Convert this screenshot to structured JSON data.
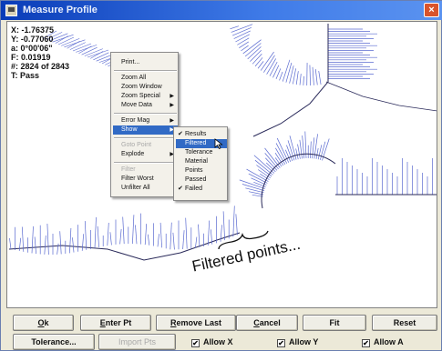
{
  "window": {
    "title": "Measure Profile",
    "close_glyph": "×"
  },
  "readout": [
    "X: -1.76375",
    "Y: -0.77060",
    "a: 0°00'06\"",
    "F: 0.01919",
    "#: 2824 of 2843",
    "T: Pass"
  ],
  "annotation": "Filtered points...",
  "context_menu": {
    "items": [
      {
        "label": "Print...",
        "disabled": false,
        "submenu": false
      },
      {
        "label": "Zoom All",
        "disabled": false,
        "submenu": false
      },
      {
        "label": "Zoom Window",
        "disabled": false,
        "submenu": false
      },
      {
        "label": "Zoom Special",
        "disabled": false,
        "submenu": true
      },
      {
        "label": "Move Data",
        "disabled": false,
        "submenu": true
      },
      {
        "label": "Error Mag",
        "disabled": false,
        "submenu": true
      },
      {
        "label": "Show",
        "disabled": false,
        "submenu": true,
        "highlighted": true
      },
      {
        "label": "Goto Point",
        "disabled": true,
        "submenu": false
      },
      {
        "label": "Explode",
        "disabled": false,
        "submenu": true
      },
      {
        "label": "Filter",
        "disabled": true,
        "submenu": false
      },
      {
        "label": "Filter Worst",
        "disabled": false,
        "submenu": false
      },
      {
        "label": "Unfilter All",
        "disabled": false,
        "submenu": false
      }
    ]
  },
  "show_submenu": {
    "items": [
      {
        "label": "Results",
        "checked": true
      },
      {
        "label": "Filtered",
        "checked": false,
        "highlighted": true
      },
      {
        "label": "Tolerance",
        "checked": false
      },
      {
        "label": "Material",
        "checked": false
      },
      {
        "label": "Points",
        "checked": false
      },
      {
        "label": "Passed",
        "checked": false
      },
      {
        "label": "Failed",
        "checked": true
      }
    ],
    "check_glyph": "✔"
  },
  "buttons": {
    "ok": {
      "hotkey": "O",
      "rest": "k"
    },
    "enter_pt": {
      "hotkey": "E",
      "rest": "nter Pt"
    },
    "remove_last": {
      "hotkey": "R",
      "rest": "emove Last"
    },
    "cancel": {
      "hotkey": "C",
      "rest": "ancel"
    },
    "fit": "Fit",
    "reset": "Reset",
    "tolerance": "Tolerance...",
    "import_pts": "Import Pts"
  },
  "checkboxes": {
    "allow_x": {
      "label": "Allow X",
      "checked": true
    },
    "allow_y": {
      "label": "Allow Y",
      "checked": true
    },
    "allow_a": {
      "label": "Allow A",
      "checked": true
    },
    "check_glyph": "✔"
  },
  "icons": {
    "app": "app-icon",
    "close": "close-icon",
    "arrow": "submenu-arrow-icon",
    "cursor": "mouse-pointer-icon"
  },
  "colors": {
    "title_bar": "#0a3cb8",
    "highlight": "#316ac5",
    "profile_line": "#5a6ad0",
    "close_button": "#d9542c"
  }
}
